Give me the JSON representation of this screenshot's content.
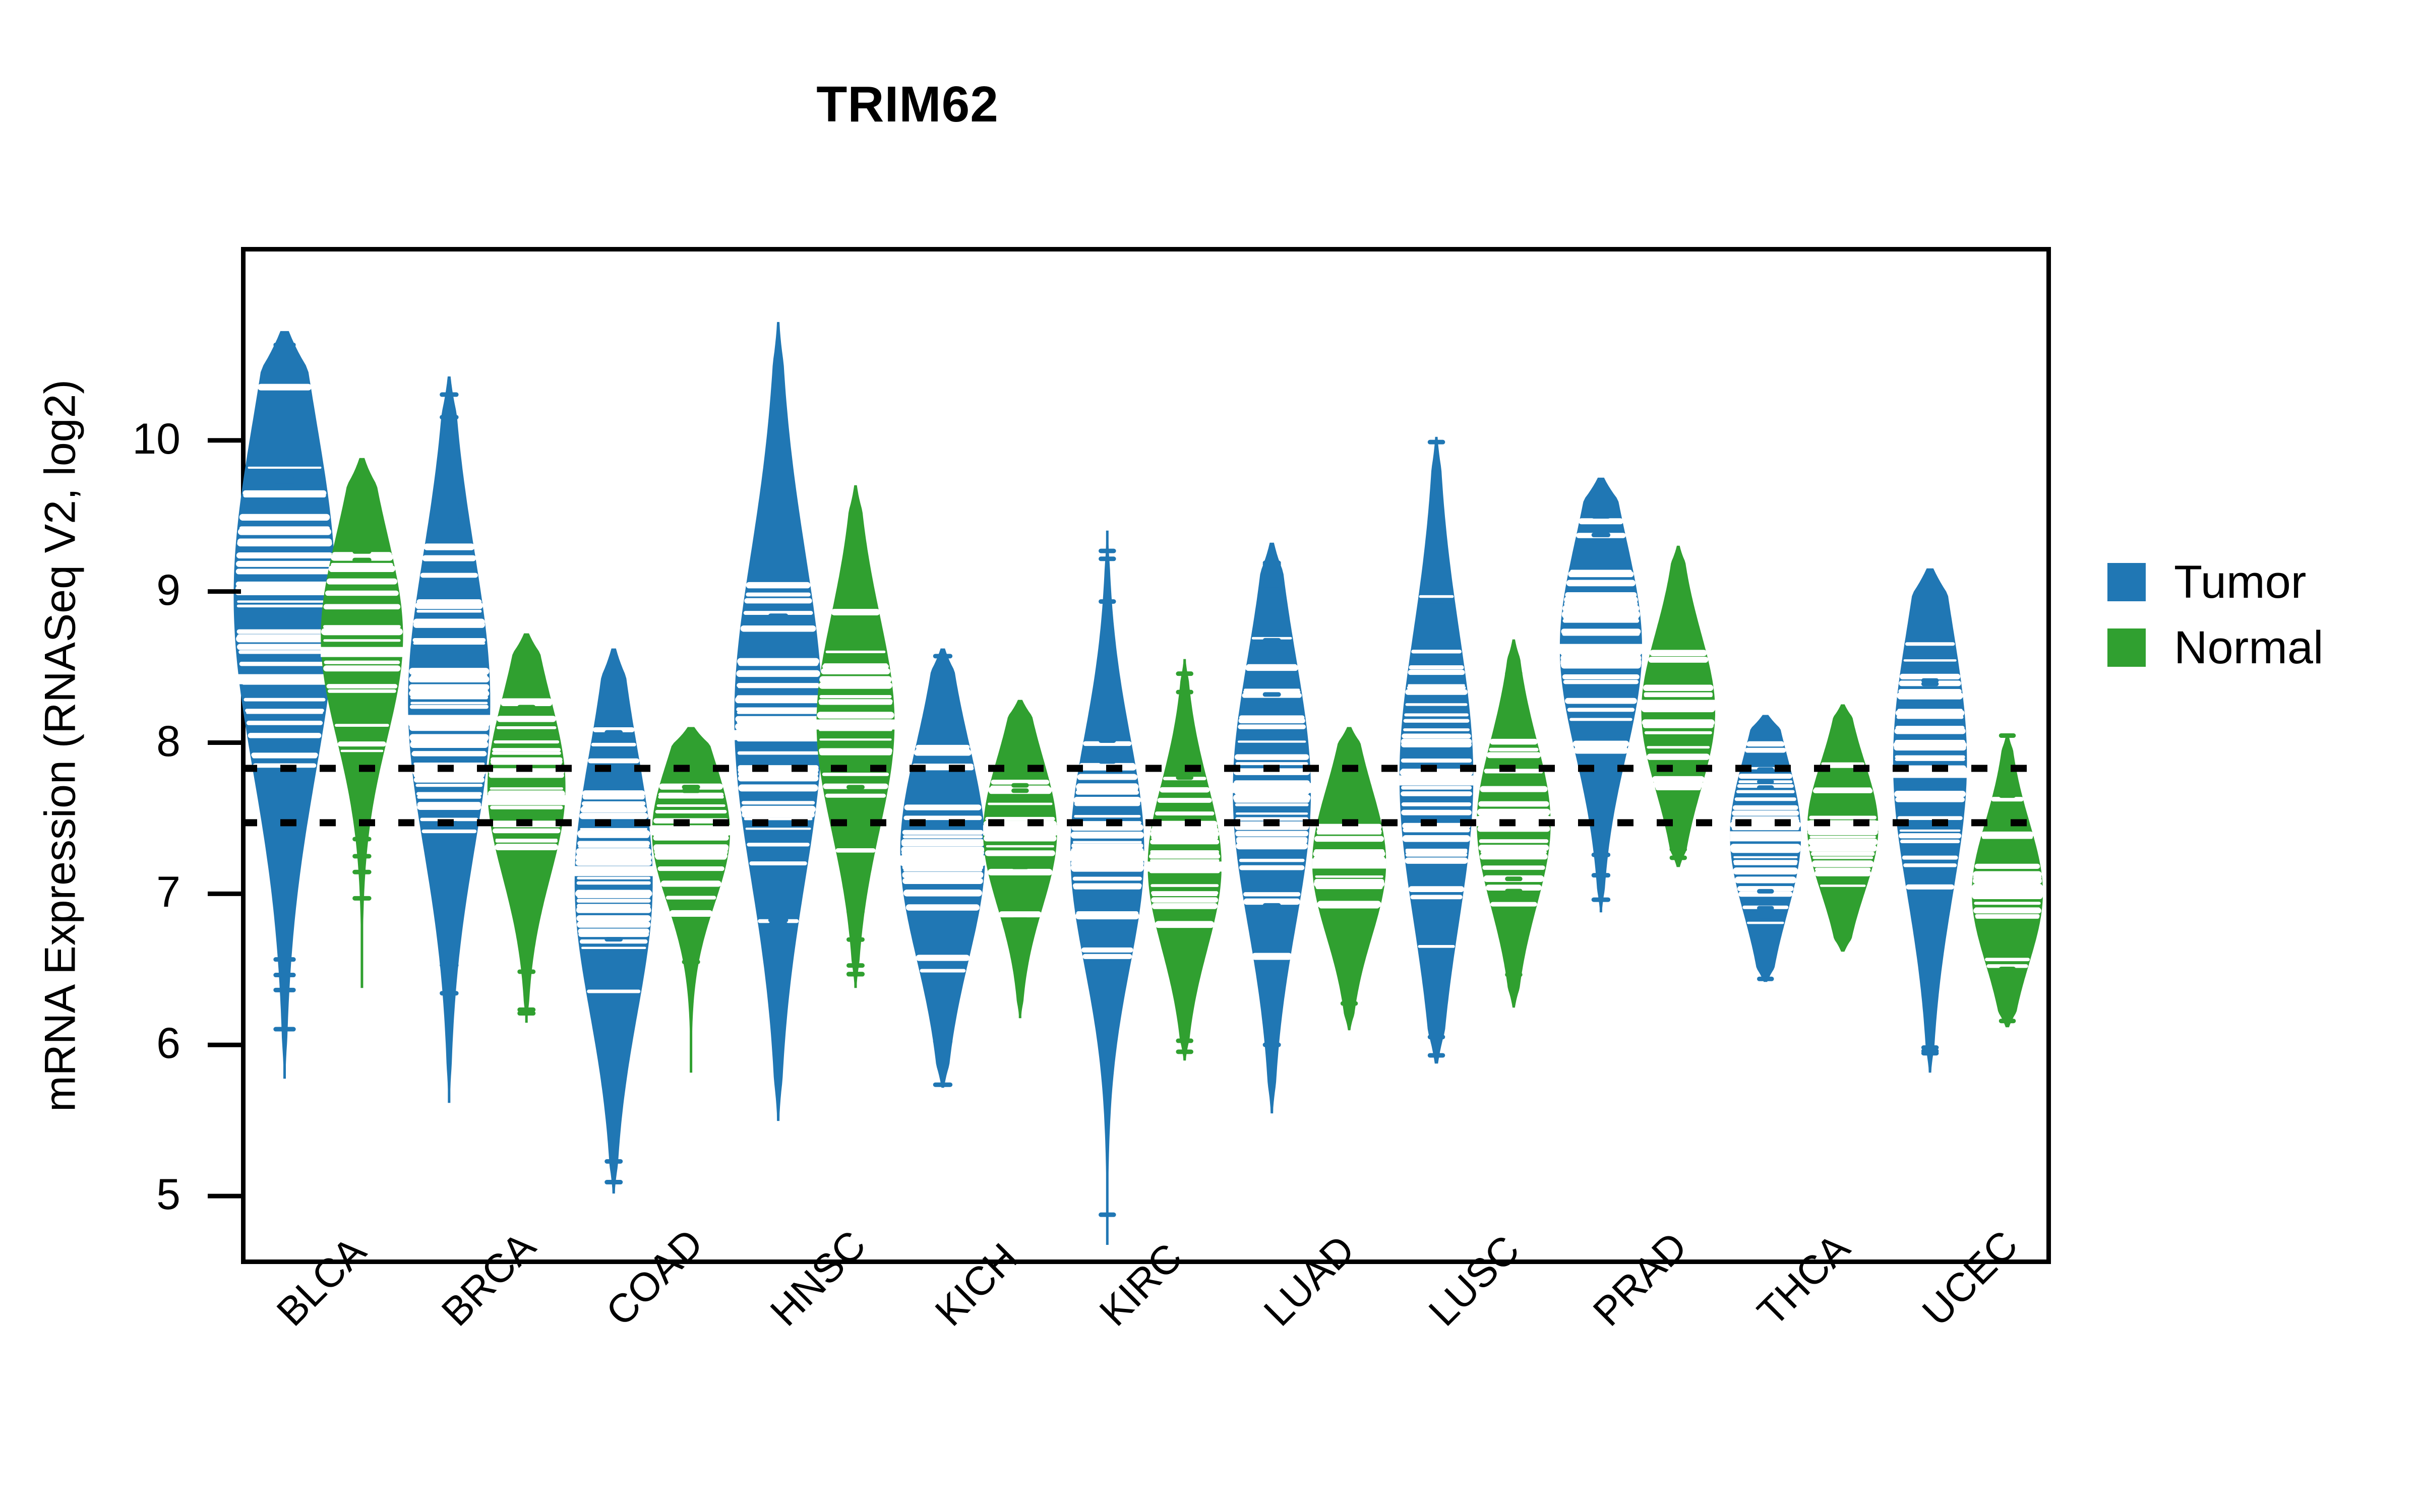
{
  "title": "TRIM62",
  "axes": {
    "ylabel": "mRNA Expression (RNASeq V2, log2)",
    "yticks": [
      5,
      6,
      7,
      8,
      9,
      10
    ],
    "ylim": [
      4.55,
      11.28
    ],
    "xlabel": ""
  },
  "legend": {
    "position": "right",
    "items": [
      {
        "label": "Tumor",
        "color": "#2077b4"
      },
      {
        "label": "Normal",
        "color": "#30a030"
      }
    ]
  },
  "reference_lines": {
    "style": "dotted",
    "color": "#000000",
    "values": [
      7.83,
      7.47
    ]
  },
  "colors": {
    "tumor": "#2077b4",
    "normal": "#30a030",
    "frame": "#000000",
    "background": "#ffffff"
  },
  "chart_data": {
    "type": "bar",
    "plot_style": "beanplot-violin",
    "title": "TRIM62",
    "xlabel": "",
    "ylabel": "mRNA Expression (RNASeq V2, log2)",
    "ylim": [
      4.55,
      11.28
    ],
    "grid": false,
    "categories": [
      "BLCA",
      "BRCA",
      "COAD",
      "HNSC",
      "KICH",
      "KIRC",
      "LUAD",
      "LUSC",
      "PRAD",
      "THCA",
      "UCEC"
    ],
    "series": [
      {
        "name": "Tumor",
        "color": "#2077b4",
        "values": [
          8.42,
          8.15,
          7.15,
          8.05,
          7.22,
          7.25,
          7.7,
          7.75,
          8.62,
          7.38,
          7.8
        ],
        "groups": [
          {
            "category": "BLCA",
            "median": 8.42,
            "min": 5.78,
            "max": 10.72,
            "q1": 7.78,
            "q3": 9.02,
            "width": 0.72,
            "mode": 9.0,
            "spread": 0.95,
            "n": 40
          },
          {
            "category": "BRCA",
            "median": 8.15,
            "min": 5.62,
            "max": 10.42,
            "q1": 7.62,
            "q3": 8.92,
            "width": 0.58,
            "mode": 8.3,
            "spread": 0.8,
            "n": 48
          },
          {
            "category": "COAD",
            "median": 7.15,
            "min": 5.02,
            "max": 8.62,
            "q1": 6.72,
            "q3": 7.62,
            "width": 0.55,
            "mode": 7.1,
            "spread": 0.7,
            "n": 42
          },
          {
            "category": "HNSC",
            "median": 8.05,
            "min": 5.5,
            "max": 10.78,
            "q1": 7.45,
            "q3": 8.7,
            "width": 0.62,
            "mode": 8.2,
            "spread": 0.88,
            "n": 45
          },
          {
            "category": "KICH",
            "median": 7.22,
            "min": 5.72,
            "max": 8.62,
            "q1": 6.82,
            "q3": 7.62,
            "width": 0.6,
            "mode": 7.3,
            "spread": 0.58,
            "n": 34
          },
          {
            "category": "KIRC",
            "median": 7.25,
            "min": 4.68,
            "max": 9.4,
            "q1": 6.85,
            "q3": 7.68,
            "width": 0.52,
            "mode": 7.3,
            "spread": 0.62,
            "n": 38
          },
          {
            "category": "LUAD",
            "median": 7.7,
            "min": 5.55,
            "max": 9.32,
            "q1": 7.08,
            "q3": 8.2,
            "width": 0.55,
            "mode": 7.7,
            "spread": 0.72,
            "n": 40
          },
          {
            "category": "LUSC",
            "median": 7.75,
            "min": 5.88,
            "max": 10.02,
            "q1": 7.18,
            "q3": 8.5,
            "width": 0.52,
            "mode": 7.8,
            "spread": 0.78,
            "n": 42
          },
          {
            "category": "PRAD",
            "median": 8.62,
            "min": 6.88,
            "max": 9.75,
            "q1": 8.1,
            "q3": 9.02,
            "width": 0.58,
            "mode": 8.65,
            "spread": 0.58,
            "n": 38
          },
          {
            "category": "THCA",
            "median": 7.38,
            "min": 6.42,
            "max": 8.18,
            "q1": 7.02,
            "q3": 7.65,
            "width": 0.5,
            "mode": 7.4,
            "spread": 0.42,
            "n": 32
          },
          {
            "category": "UCEC",
            "median": 7.8,
            "min": 5.82,
            "max": 9.15,
            "q1": 7.08,
            "q3": 8.2,
            "width": 0.52,
            "mode": 7.9,
            "spread": 0.72,
            "n": 36
          }
        ]
      },
      {
        "name": "Normal",
        "color": "#30a030",
        "groups": [
          {
            "category": "BLCA",
            "median": 8.6,
            "min": 6.38,
            "max": 9.88,
            "q1": 8.18,
            "q3": 8.98,
            "width": 0.58,
            "mode": 8.72,
            "spread": 0.55,
            "n": 22
          },
          {
            "category": "BRCA",
            "median": 7.62,
            "min": 6.15,
            "max": 8.72,
            "q1": 7.28,
            "q3": 8.02,
            "width": 0.55,
            "mode": 7.72,
            "spread": 0.48,
            "n": 26
          },
          {
            "category": "COAD",
            "median": 7.42,
            "min": 5.82,
            "max": 8.1,
            "q1": 7.12,
            "q3": 7.62,
            "width": 0.55,
            "mode": 7.42,
            "spread": 0.38,
            "n": 22
          },
          {
            "category": "HNSC",
            "median": 8.12,
            "min": 6.38,
            "max": 9.7,
            "q1": 7.72,
            "q3": 8.6,
            "width": 0.55,
            "mode": 8.15,
            "spread": 0.58,
            "n": 24
          },
          {
            "category": "KICH",
            "median": 7.42,
            "min": 6.18,
            "max": 8.28,
            "q1": 7.18,
            "q3": 7.68,
            "width": 0.52,
            "mode": 7.42,
            "spread": 0.4,
            "n": 20
          },
          {
            "category": "KIRC",
            "median": 7.18,
            "min": 5.9,
            "max": 8.55,
            "q1": 6.92,
            "q3": 7.52,
            "width": 0.52,
            "mode": 7.2,
            "spread": 0.45,
            "n": 24
          },
          {
            "category": "LUAD",
            "median": 7.2,
            "min": 6.1,
            "max": 8.1,
            "q1": 6.95,
            "q3": 7.45,
            "width": 0.52,
            "mode": 7.22,
            "spread": 0.4,
            "n": 22
          },
          {
            "category": "LUSC",
            "median": 7.48,
            "min": 6.25,
            "max": 8.68,
            "q1": 7.18,
            "q3": 7.82,
            "width": 0.52,
            "mode": 7.48,
            "spread": 0.45,
            "n": 22
          },
          {
            "category": "PRAD",
            "median": 8.25,
            "min": 7.18,
            "max": 9.3,
            "q1": 7.95,
            "q3": 8.52,
            "width": 0.52,
            "mode": 8.22,
            "spread": 0.42,
            "n": 20
          },
          {
            "category": "THCA",
            "median": 7.45,
            "min": 6.62,
            "max": 8.25,
            "q1": 7.22,
            "q3": 7.7,
            "width": 0.5,
            "mode": 7.45,
            "spread": 0.35,
            "n": 24
          },
          {
            "category": "UCEC",
            "median": 7.02,
            "min": 6.12,
            "max": 8.05,
            "q1": 6.8,
            "q3": 7.32,
            "width": 0.5,
            "mode": 7.02,
            "spread": 0.38,
            "n": 20
          }
        ]
      }
    ],
    "reference_lines": [
      7.83,
      7.47
    ]
  }
}
